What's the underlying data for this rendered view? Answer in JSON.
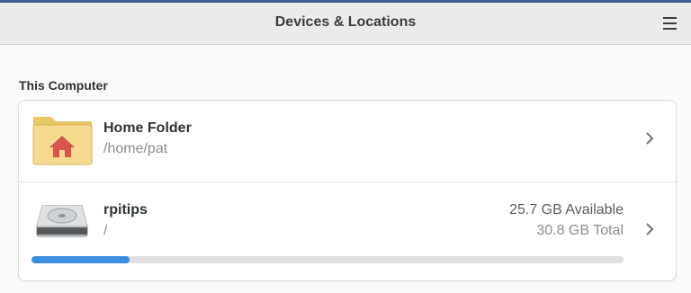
{
  "header": {
    "title": "Devices & Locations",
    "menu_icon": "hamburger-menu-icon"
  },
  "section": {
    "title": "This Computer"
  },
  "locations": [
    {
      "icon": "home-folder-icon",
      "name": "Home Folder",
      "path": "/home/pat"
    },
    {
      "icon": "hard-disk-icon",
      "name": "rpitips",
      "path": "/",
      "available": "25.7 GB Available",
      "total": "30.8 GB Total",
      "usage_fraction": 0.166
    }
  ],
  "colors": {
    "accent": "#3d8ee0",
    "folder": "#f3d68a",
    "home_glyph": "#d9534f"
  }
}
